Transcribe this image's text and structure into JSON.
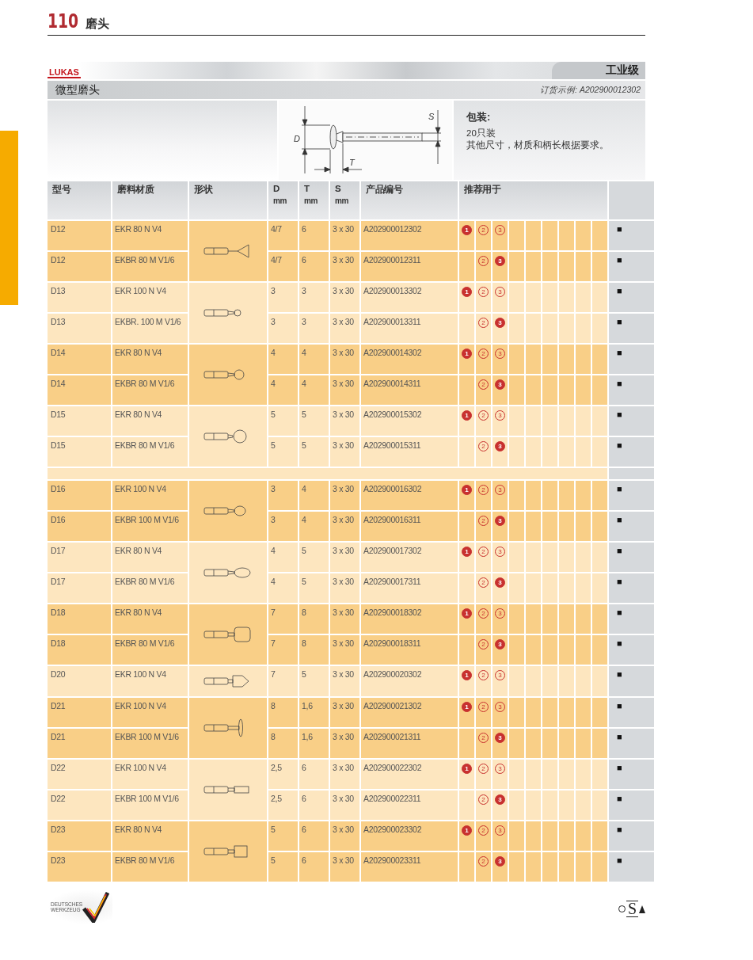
{
  "page_header": {
    "page_number": "110",
    "title": "磨头"
  },
  "brand_band": {
    "logo": "LUKAS",
    "grade_tab": "工业级"
  },
  "section_bar": {
    "title": "微型磨头",
    "order_example": "订货示例: A202900012302"
  },
  "info": {
    "diagram_labels": {
      "d": "D",
      "t": "T",
      "s": "S"
    },
    "packaging_title": "包装:",
    "packaging_lines": [
      "20只装",
      "其他尺寸，材质和柄长根据要求。"
    ]
  },
  "table": {
    "columns": [
      {
        "label": "型号"
      },
      {
        "label": "磨料材质"
      },
      {
        "label": "形状"
      },
      {
        "label": "D",
        "unit": "mm"
      },
      {
        "label": "T",
        "unit": "mm"
      },
      {
        "label": "S",
        "unit": "mm"
      },
      {
        "label": "产品编号"
      },
      {
        "label": "推荐用于"
      }
    ],
    "groups": [
      {
        "kind": "cone",
        "blank_row_after": false,
        "rows": [
          {
            "type": "D12",
            "material": "EKR 80 N V4",
            "d": "4/7",
            "t": "6",
            "s": "3 x 30",
            "product_no": "A202900012302",
            "mark_1": {
              "label": "1",
              "filled": true
            },
            "mark_2": {
              "label": "2",
              "filled": false
            },
            "mark_3": {
              "label": "3",
              "filled": false
            },
            "availability": "■"
          },
          {
            "type": "D12",
            "material": "EKBR 80 M V1/6",
            "d": "4/7",
            "t": "6",
            "s": "3 x 30",
            "product_no": "A202900012311",
            "mark_2": {
              "label": "2",
              "filled": false
            },
            "mark_3": {
              "label": "3",
              "filled": true
            },
            "availability": "■"
          }
        ]
      },
      {
        "kind": "small-ball",
        "blank_row_after": false,
        "rows": [
          {
            "type": "D13",
            "material": "EKR 100 N V4",
            "d": "3",
            "t": "3",
            "s": "3 x 30",
            "product_no": "A202900013302",
            "mark_1": {
              "label": "1",
              "filled": true
            },
            "mark_2": {
              "label": "2",
              "filled": false
            },
            "mark_3": {
              "label": "3",
              "filled": false
            },
            "availability": "■"
          },
          {
            "type": "D13",
            "material": "EKBR. 100 M V1/6",
            "d": "3",
            "t": "3",
            "s": "3 x 30",
            "product_no": "A202900013311",
            "mark_2": {
              "label": "2",
              "filled": false
            },
            "mark_3": {
              "label": "3",
              "filled": true
            },
            "availability": "■"
          }
        ]
      },
      {
        "kind": "ball",
        "blank_row_after": false,
        "rows": [
          {
            "type": "D14",
            "material": "EKR 80 N V4",
            "d": "4",
            "t": "4",
            "s": "3 x 30",
            "product_no": "A202900014302",
            "mark_1": {
              "label": "1",
              "filled": true
            },
            "mark_2": {
              "label": "2",
              "filled": false
            },
            "mark_3": {
              "label": "3",
              "filled": false
            },
            "availability": "■"
          },
          {
            "type": "D14",
            "material": "EKBR 80 M V1/6",
            "d": "4",
            "t": "4",
            "s": "3 x 30",
            "product_no": "A202900014311",
            "mark_2": {
              "label": "2",
              "filled": false
            },
            "mark_3": {
              "label": "3",
              "filled": true
            },
            "availability": "■"
          }
        ]
      },
      {
        "kind": "large-ball",
        "blank_row_after": true,
        "rows": [
          {
            "type": "D15",
            "material": "EKR 80 N V4",
            "d": "5",
            "t": "5",
            "s": "3 x 30",
            "product_no": "A202900015302",
            "mark_1": {
              "label": "1",
              "filled": true
            },
            "mark_2": {
              "label": "2",
              "filled": false
            },
            "mark_3": {
              "label": "3",
              "filled": false
            },
            "availability": "■"
          },
          {
            "type": "D15",
            "material": "EKBR 80 M V1/6",
            "d": "5",
            "t": "5",
            "s": "3 x 30",
            "product_no": "A202900015311",
            "mark_2": {
              "label": "2",
              "filled": false
            },
            "mark_3": {
              "label": "3",
              "filled": true
            },
            "availability": "■"
          }
        ]
      },
      {
        "kind": "necked-ball",
        "blank_row_after": false,
        "rows": [
          {
            "type": "D16",
            "material": "EKR 100 N V4",
            "d": "3",
            "t": "4",
            "s": "3 x 30",
            "product_no": "A202900016302",
            "mark_1": {
              "label": "1",
              "filled": true
            },
            "mark_2": {
              "label": "2",
              "filled": false
            },
            "mark_3": {
              "label": "3",
              "filled": false
            },
            "availability": "■"
          },
          {
            "type": "D16",
            "material": "EKBR 100 M V1/6",
            "d": "3",
            "t": "4",
            "s": "3 x 30",
            "product_no": "A202900016311",
            "mark_2": {
              "label": "2",
              "filled": false
            },
            "mark_3": {
              "label": "3",
              "filled": true
            },
            "availability": "■"
          }
        ]
      },
      {
        "kind": "oval",
        "blank_row_after": false,
        "rows": [
          {
            "type": "D17",
            "material": "EKR 80 N V4",
            "d": "4",
            "t": "5",
            "s": "3 x 30",
            "product_no": "A202900017302",
            "mark_1": {
              "label": "1",
              "filled": true
            },
            "mark_2": {
              "label": "2",
              "filled": false
            },
            "mark_3": {
              "label": "3",
              "filled": false
            },
            "availability": "■"
          },
          {
            "type": "D17",
            "material": "EKBR 80 M V1/6",
            "d": "4",
            "t": "5",
            "s": "3 x 30",
            "product_no": "A202900017311",
            "mark_2": {
              "label": "2",
              "filled": false
            },
            "mark_3": {
              "label": "3",
              "filled": true
            },
            "availability": "■"
          }
        ]
      },
      {
        "kind": "barrel",
        "blank_row_after": false,
        "rows": [
          {
            "type": "D18",
            "material": "EKR 80 N V4",
            "d": "7",
            "t": "8",
            "s": "3 x 30",
            "product_no": "A202900018302",
            "mark_1": {
              "label": "1",
              "filled": true
            },
            "mark_2": {
              "label": "2",
              "filled": false
            },
            "mark_3": {
              "label": "3",
              "filled": false
            },
            "availability": "■"
          },
          {
            "type": "D18",
            "material": "EKBR 80 M V1/6",
            "d": "7",
            "t": "8",
            "s": "3 x 30",
            "product_no": "A202900018311",
            "mark_2": {
              "label": "2",
              "filled": false
            },
            "mark_3": {
              "label": "3",
              "filled": true
            },
            "availability": "■"
          }
        ]
      },
      {
        "kind": "point",
        "blank_row_after": false,
        "rows": [
          {
            "type": "D20",
            "material": "EKR 100 N V4",
            "d": "7",
            "t": "5",
            "s": "3 x 30",
            "product_no": "A202900020302",
            "mark_1": {
              "label": "1",
              "filled": true
            },
            "mark_2": {
              "label": "2",
              "filled": false
            },
            "mark_3": {
              "label": "3",
              "filled": false
            },
            "availability": "■"
          }
        ]
      },
      {
        "kind": "disc",
        "blank_row_after": false,
        "rows": [
          {
            "type": "D21",
            "material": "EKR 100 N V4",
            "d": "8",
            "t": "1,6",
            "s": "3 x 30",
            "product_no": "A202900021302",
            "mark_1": {
              "label": "1",
              "filled": true
            },
            "mark_2": {
              "label": "2",
              "filled": false
            },
            "mark_3": {
              "label": "3",
              "filled": false
            },
            "availability": "■"
          },
          {
            "type": "D21",
            "material": "EKBR 100 M V1/6",
            "d": "8",
            "t": "1,6",
            "s": "3 x 30",
            "product_no": "A202900021311",
            "mark_2": {
              "label": "2",
              "filled": false
            },
            "mark_3": {
              "label": "3",
              "filled": true
            },
            "availability": "■"
          }
        ]
      },
      {
        "kind": "small-cylinder",
        "blank_row_after": false,
        "rows": [
          {
            "type": "D22",
            "material": "EKR 100 N V4",
            "d": "2,5",
            "t": "6",
            "s": "3 x 30",
            "product_no": "A202900022302",
            "mark_1": {
              "label": "1",
              "filled": true
            },
            "mark_2": {
              "label": "2",
              "filled": false
            },
            "mark_3": {
              "label": "3",
              "filled": false
            },
            "availability": "■"
          },
          {
            "type": "D22",
            "material": "EKBR 100 M V1/6",
            "d": "2,5",
            "t": "6",
            "s": "3 x 30",
            "product_no": "A202900022311",
            "mark_2": {
              "label": "2",
              "filled": false
            },
            "mark_3": {
              "label": "3",
              "filled": true
            },
            "availability": "■"
          }
        ]
      },
      {
        "kind": "cylinder",
        "blank_row_after": false,
        "rows": [
          {
            "type": "D23",
            "material": "EKR 80 N V4",
            "d": "5",
            "t": "6",
            "s": "3 x 30",
            "product_no": "A202900023302",
            "mark_1": {
              "label": "1",
              "filled": true
            },
            "mark_2": {
              "label": "2",
              "filled": false
            },
            "mark_3": {
              "label": "3",
              "filled": false
            },
            "availability": "■"
          },
          {
            "type": "D23",
            "material": "EKBR 80 M V1/6",
            "d": "5",
            "t": "6",
            "s": "3 x 30",
            "product_no": "A202900023311",
            "mark_2": {
              "label": "2",
              "filled": false
            },
            "mark_3": {
              "label": "3",
              "filled": true
            },
            "availability": "■"
          }
        ]
      }
    ]
  },
  "footer": {
    "quality_logo_lines": [
      "DEUTSCHES",
      "WERKZEUG"
    ],
    "osa_logo": "S"
  }
}
